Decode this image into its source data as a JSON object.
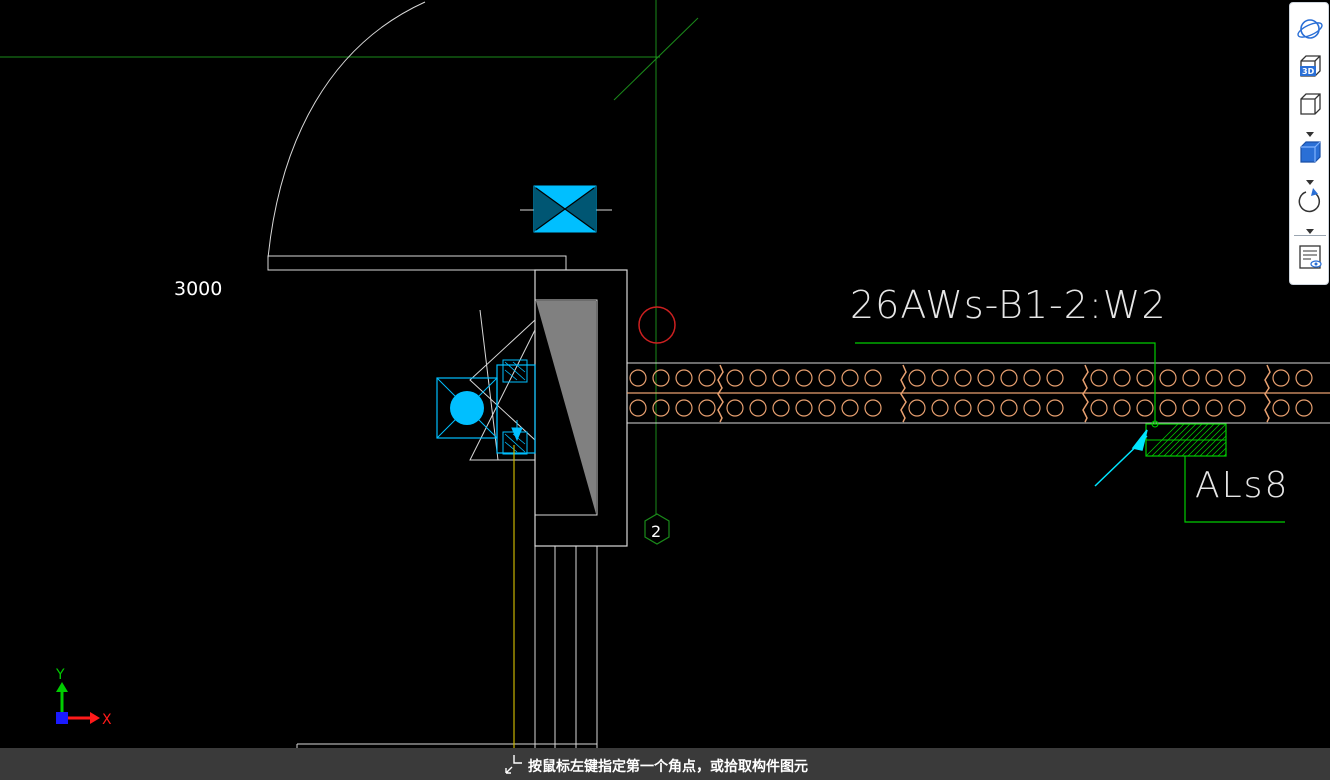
{
  "drawing": {
    "dimension_text": "3000",
    "wall_tag": "26AWs-B1-2:W2",
    "element_tag": "ALs8",
    "axis_number": "2"
  },
  "ucs": {
    "x_label": "X",
    "y_label": "Y"
  },
  "toolbar": {
    "orbit_label": "",
    "view3d_label": "3D",
    "box_view_label": "",
    "shaded_view_label": "",
    "rotate_label": "",
    "properties_label": ""
  },
  "status": {
    "prompt": "按鼠标左键指定第一个角点，或拾取构件图元"
  },
  "colors": {
    "background": "#000000",
    "line_white": "#d9d9d9",
    "axis_green": "#1a8a1a",
    "cyan": "#00bfff",
    "brick_orange": "#e8a070",
    "leader_green": "#00cc00",
    "status_bar": "#3a3a3a"
  }
}
